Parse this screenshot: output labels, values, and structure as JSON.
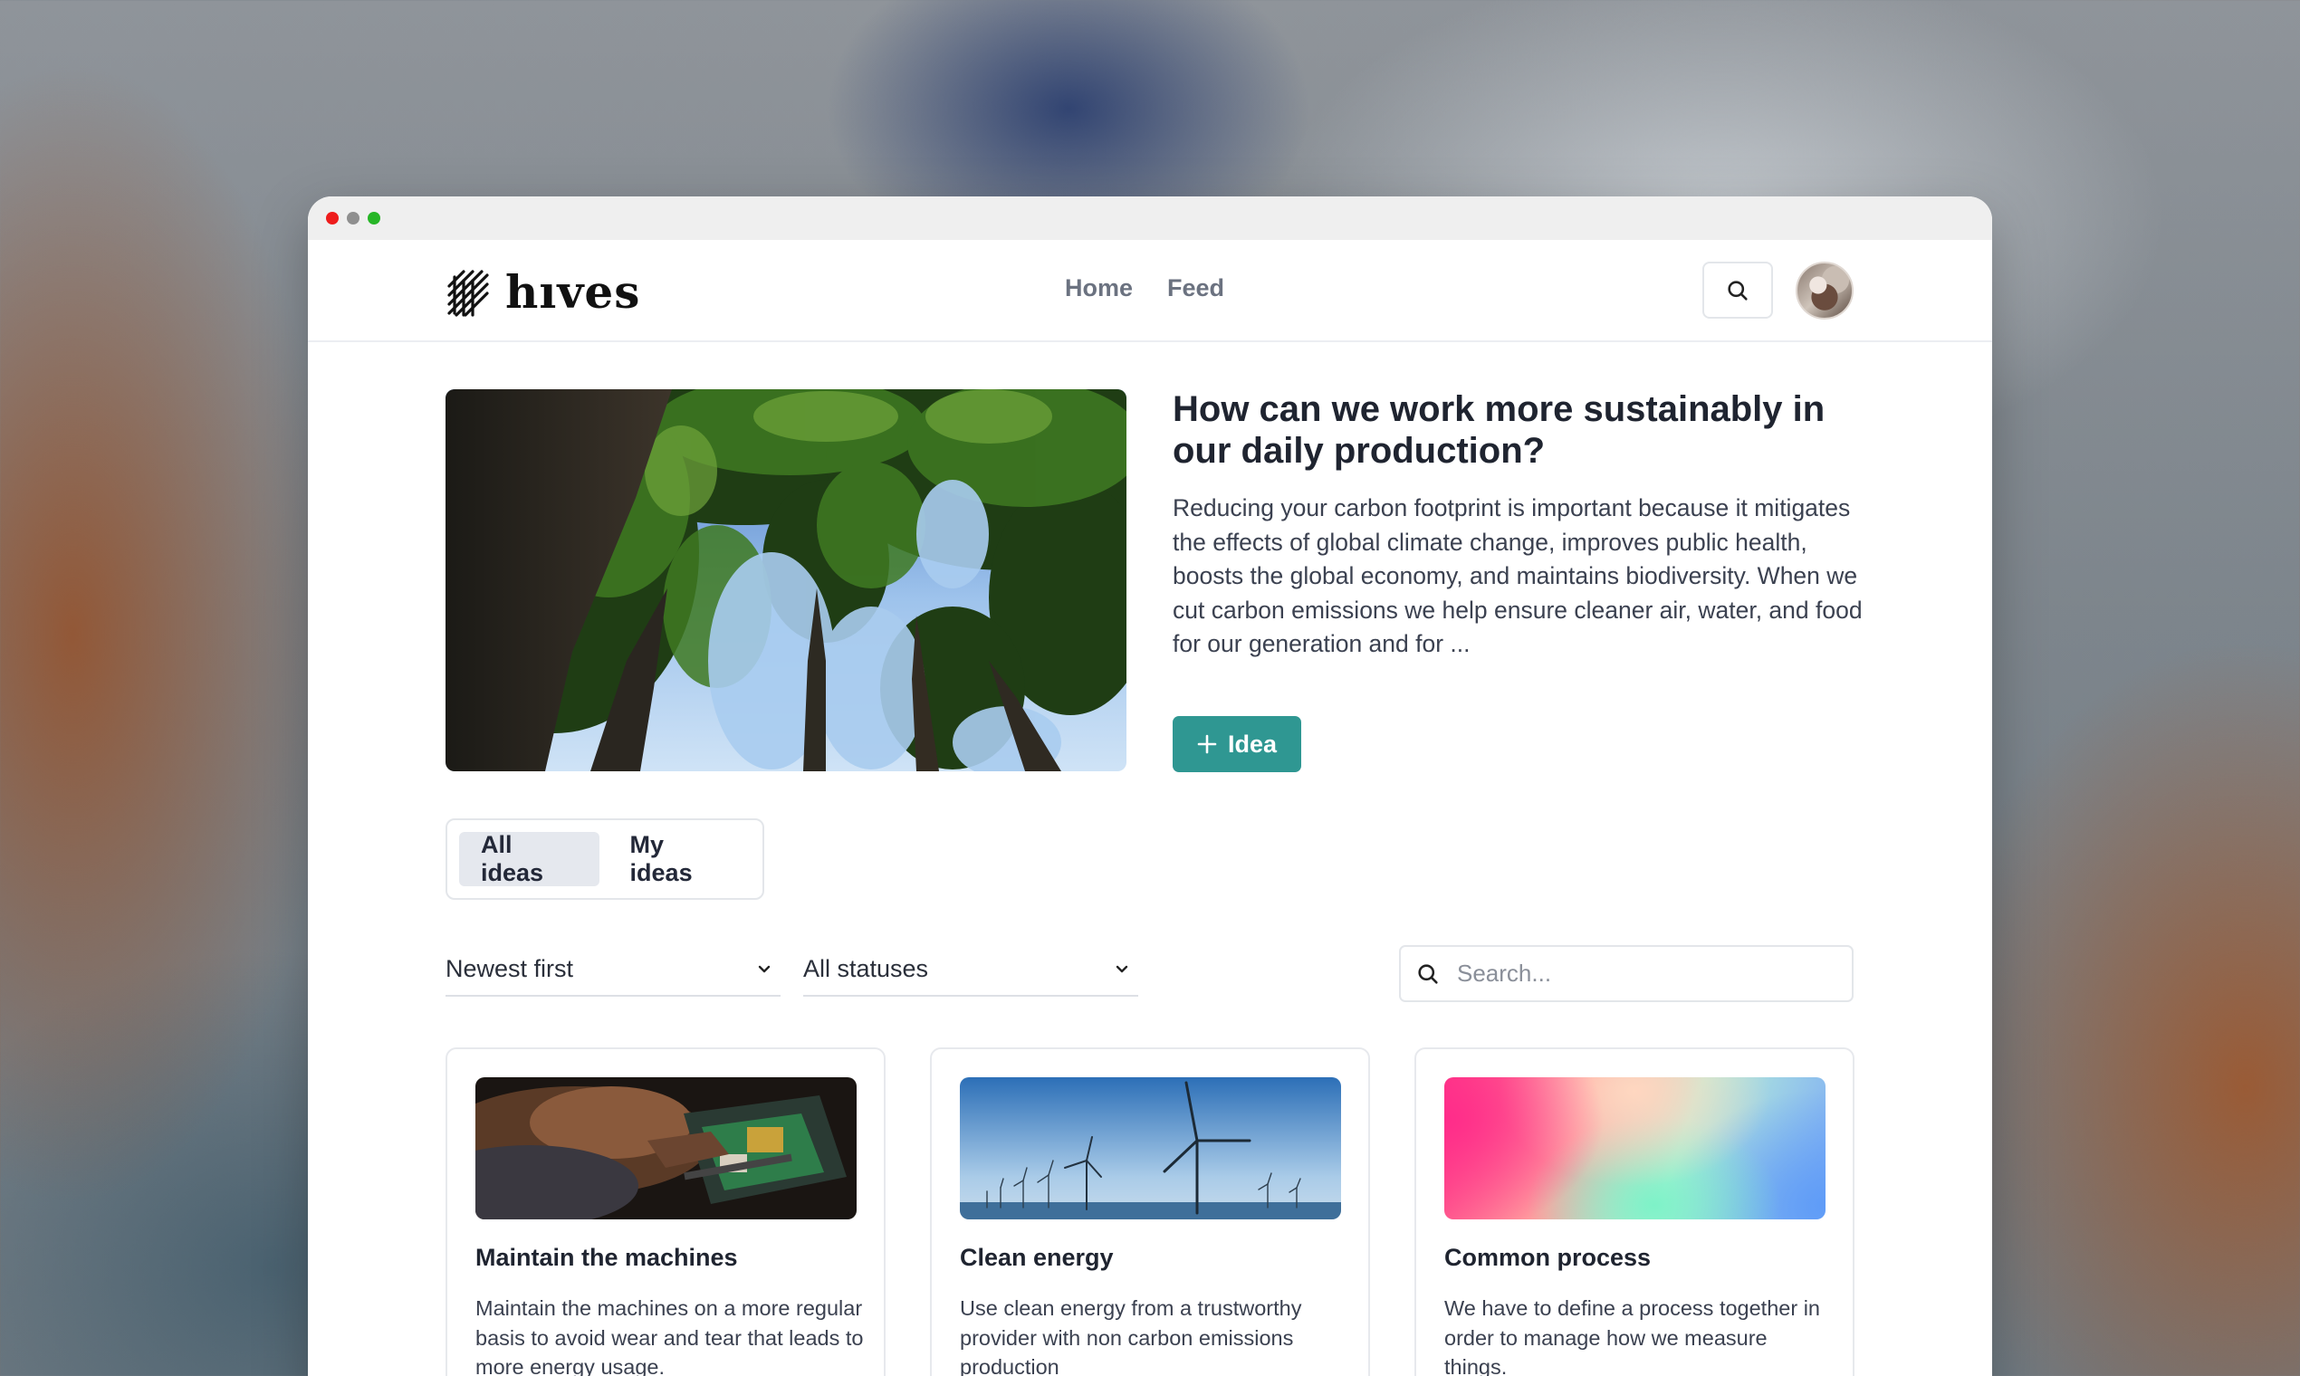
{
  "app": {
    "logo_text": "hıves"
  },
  "nav": {
    "links": [
      "Home",
      "Feed"
    ]
  },
  "hero": {
    "title": "How can we work more sustainably in our daily production?",
    "description": "Reducing your carbon footprint is important because it mitigates the effects of global climate change, improves public health, boosts the global economy, and maintains biodiversity. When we cut carbon emissions we help ensure cleaner air, water, and food for our generation and for ...",
    "button_label": "Idea"
  },
  "tabs": [
    {
      "label": "All ideas",
      "active": true
    },
    {
      "label": "My ideas",
      "active": false
    }
  ],
  "filters": {
    "sort": {
      "value": "Newest first"
    },
    "status": {
      "value": "All statuses"
    },
    "search": {
      "placeholder": "Search..."
    }
  },
  "cards": [
    {
      "title": "Maintain the machines",
      "description": "Maintain the machines on a more regular basis to avoid wear and tear that leads to more energy usage.",
      "image": "machine-repair"
    },
    {
      "title": "Clean energy",
      "description": "Use clean energy from a trustworthy provider with non carbon emissions production",
      "image": "wind-turbines"
    },
    {
      "title": "Common process",
      "description": "We have to define a process together in order to manage how we measure things.",
      "image": "gradient"
    }
  ],
  "colors": {
    "accent": "#2f9792",
    "text_dark": "#1f2430",
    "text_muted": "#6b7280"
  }
}
